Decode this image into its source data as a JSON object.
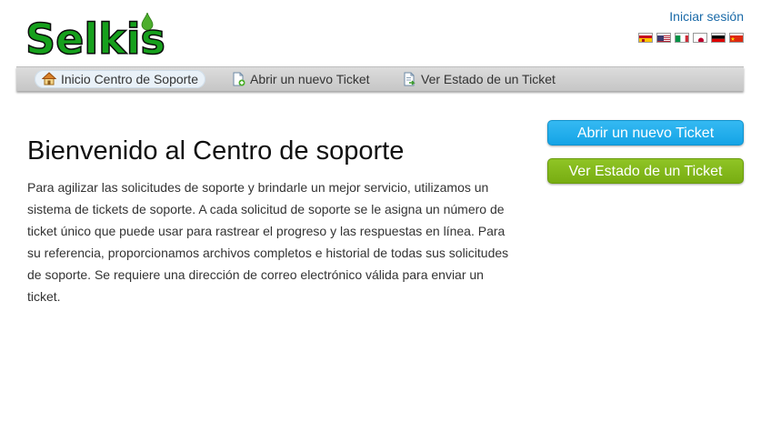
{
  "header": {
    "logo_text": "Selkis",
    "signin_label": "Iniciar sesión",
    "languages": [
      {
        "name": "Español",
        "icon": "spain-flag-icon"
      },
      {
        "name": "English",
        "icon": "us-flag-icon"
      },
      {
        "name": "Italiano",
        "icon": "italy-flag-icon"
      },
      {
        "name": "日本語",
        "icon": "japan-flag-icon"
      },
      {
        "name": "Deutsch",
        "icon": "germany-flag-icon"
      },
      {
        "name": "中文",
        "icon": "china-flag-icon"
      }
    ]
  },
  "nav": {
    "items": [
      {
        "label": "Inicio Centro de Soporte",
        "icon": "home-icon",
        "active": true
      },
      {
        "label": "Abrir un nuevo Ticket",
        "icon": "new-ticket-icon",
        "active": false
      },
      {
        "label": "Ver Estado de un Ticket",
        "icon": "ticket-status-icon",
        "active": false
      }
    ]
  },
  "main": {
    "title": "Bienvenido al Centro de soporte",
    "intro": "Para agilizar las solicitudes de soporte y brindarle un mejor servicio, utilizamos un sistema de tickets de soporte. A cada solicitud de soporte se le asigna un número de ticket único que puede usar para rastrear el progreso y las respuestas en línea. Para su referencia, proporcionamos archivos completos e historial de todas sus solicitudes de soporte. Se requiere una dirección de correo electrónico válida para enviar un ticket."
  },
  "sidebar": {
    "open_ticket_label": "Abrir un nuevo Ticket",
    "check_status_label": "Ver Estado de un Ticket"
  },
  "colors": {
    "brand_green": "#16a01c",
    "button_blue": "#14a4e6",
    "button_green": "#78ad12",
    "link_blue": "#1a6aa8"
  }
}
